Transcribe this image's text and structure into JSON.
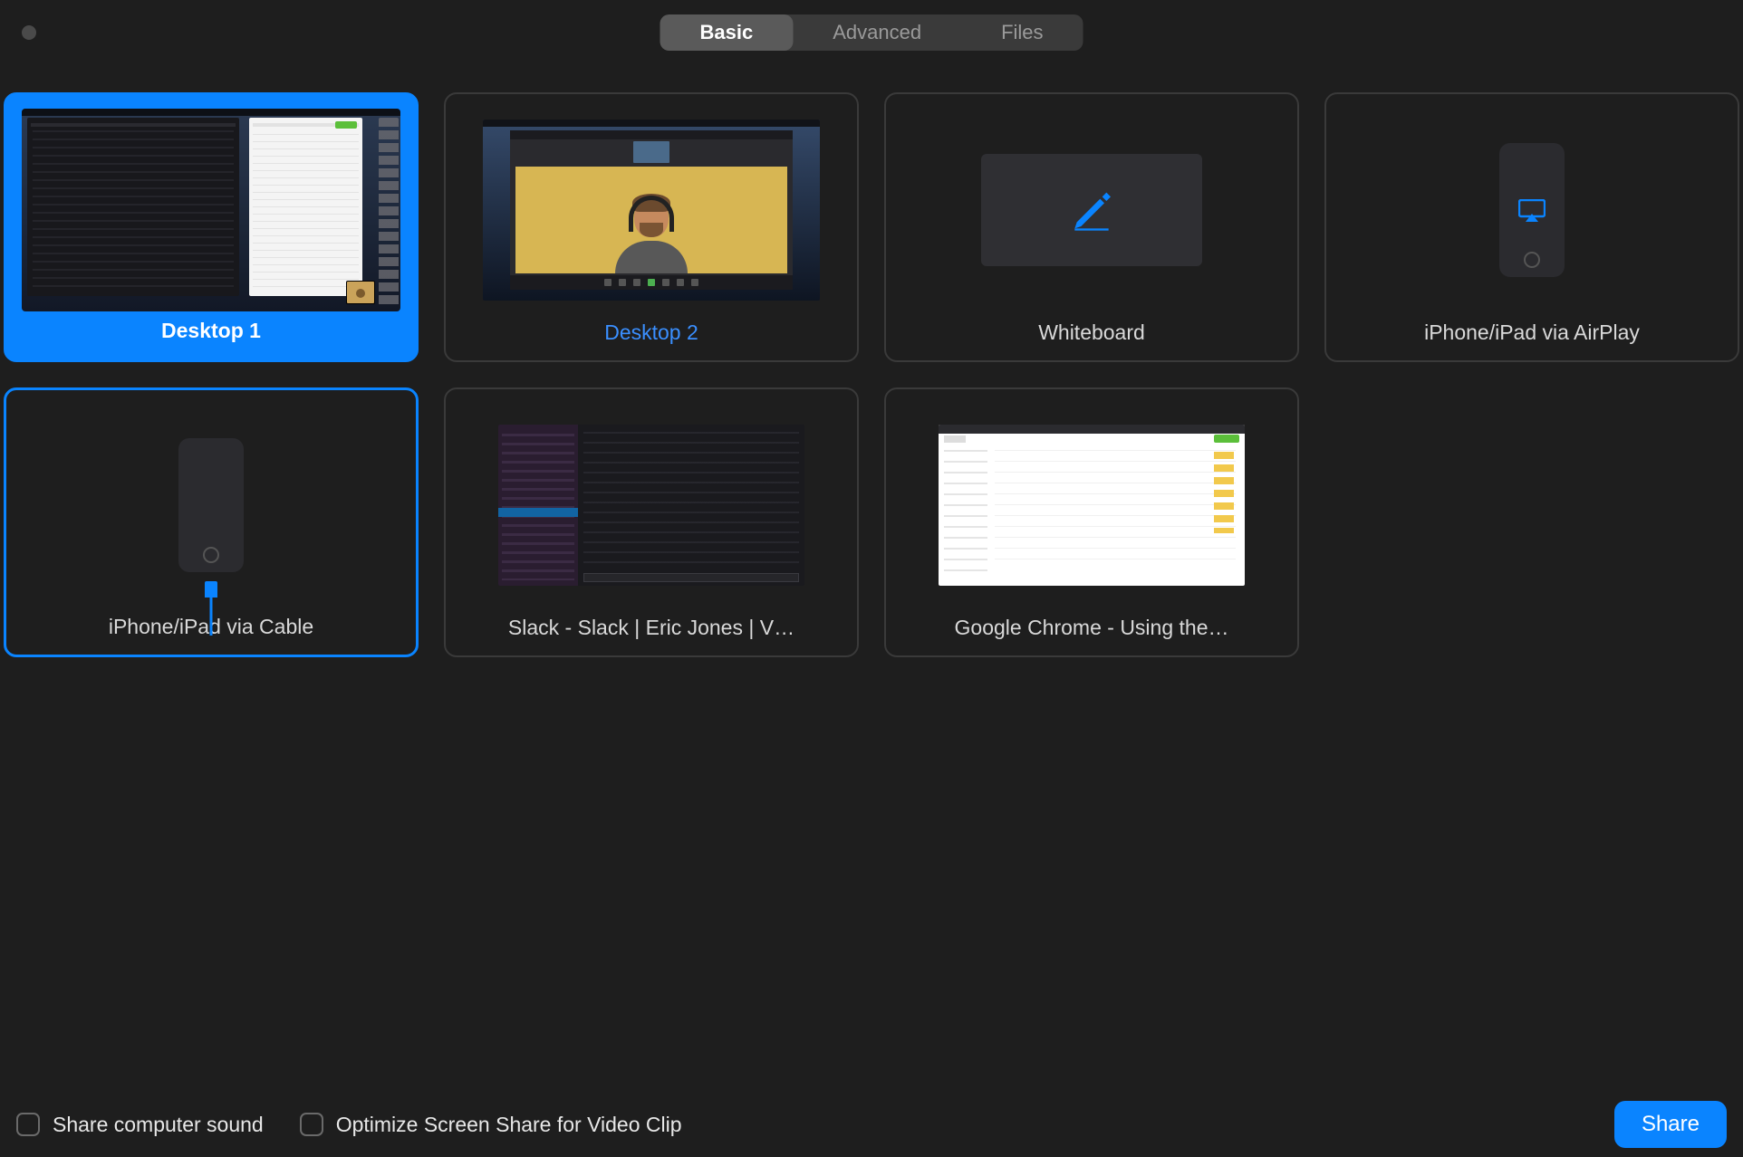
{
  "tabs": {
    "basic": "Basic",
    "advanced": "Advanced",
    "files": "Files",
    "active": "basic"
  },
  "tiles": {
    "desktop1": {
      "label": "Desktop 1",
      "selected": true
    },
    "desktop2": {
      "label": "Desktop 2"
    },
    "whiteboard": {
      "label": "Whiteboard"
    },
    "airplay": {
      "label": "iPhone/iPad via AirPlay"
    },
    "cable": {
      "label": "iPhone/iPad via Cable",
      "outlined": true
    },
    "slack": {
      "label": "Slack - Slack | Eric Jones | V…"
    },
    "chrome": {
      "label": "Google Chrome - Using the…"
    }
  },
  "footer": {
    "share_sound": "Share computer sound",
    "optimize_clip": "Optimize Screen Share for Video Clip",
    "share_button": "Share"
  },
  "colors": {
    "accent": "#0a84ff",
    "bg": "#1e1e1e"
  }
}
